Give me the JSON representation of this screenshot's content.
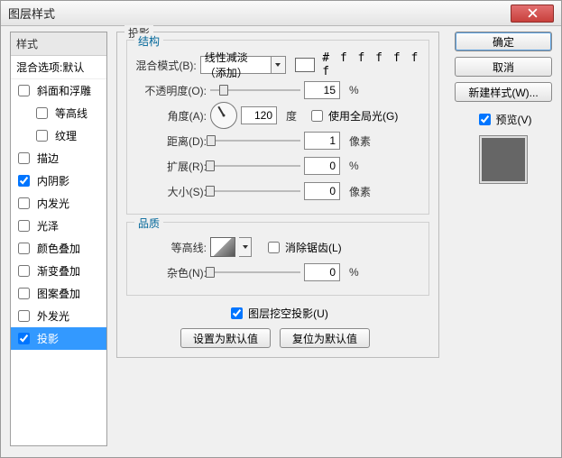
{
  "window": {
    "title": "图层样式"
  },
  "styles": {
    "header": "样式",
    "blending_row": "混合选项:默认",
    "items": [
      {
        "label": "斜面和浮雕",
        "checked": false,
        "indent": false
      },
      {
        "label": "等高线",
        "checked": false,
        "indent": true
      },
      {
        "label": "纹理",
        "checked": false,
        "indent": true
      },
      {
        "label": "描边",
        "checked": false,
        "indent": false
      },
      {
        "label": "内阴影",
        "checked": true,
        "indent": false
      },
      {
        "label": "内发光",
        "checked": false,
        "indent": false
      },
      {
        "label": "光泽",
        "checked": false,
        "indent": false
      },
      {
        "label": "颜色叠加",
        "checked": false,
        "indent": false
      },
      {
        "label": "渐变叠加",
        "checked": false,
        "indent": false
      },
      {
        "label": "图案叠加",
        "checked": false,
        "indent": false
      },
      {
        "label": "外发光",
        "checked": false,
        "indent": false
      },
      {
        "label": "投影",
        "checked": true,
        "indent": false,
        "selected": true
      }
    ]
  },
  "main": {
    "legend": "投影",
    "structure": {
      "legend": "结构",
      "blend_mode_label": "混合模式(B):",
      "blend_mode_value": "线性减淡（添加）",
      "color_hex": "# f f f f f f",
      "opacity_label": "不透明度(O):",
      "opacity_value": "15",
      "opacity_unit": "%",
      "angle_label": "角度(A):",
      "angle_value": "120",
      "angle_unit": "度",
      "global_light_label": "使用全局光(G)",
      "global_light_checked": false,
      "distance_label": "距离(D):",
      "distance_value": "1",
      "distance_unit": "像素",
      "spread_label": "扩展(R):",
      "spread_value": "0",
      "spread_unit": "%",
      "size_label": "大小(S):",
      "size_value": "0",
      "size_unit": "像素"
    },
    "quality": {
      "legend": "品质",
      "contour_label": "等高线:",
      "antialiased_label": "消除锯齿(L)",
      "antialiased_checked": false,
      "noise_label": "杂色(N):",
      "noise_value": "0",
      "noise_unit": "%"
    },
    "knockout": {
      "label": "图层挖空投影(U)",
      "checked": true
    },
    "buttons": {
      "set_default": "设置为默认值",
      "reset_default": "复位为默认值"
    }
  },
  "right": {
    "ok": "确定",
    "cancel": "取消",
    "new_style": "新建样式(W)...",
    "preview_label": "预览(V)",
    "preview_checked": true
  }
}
